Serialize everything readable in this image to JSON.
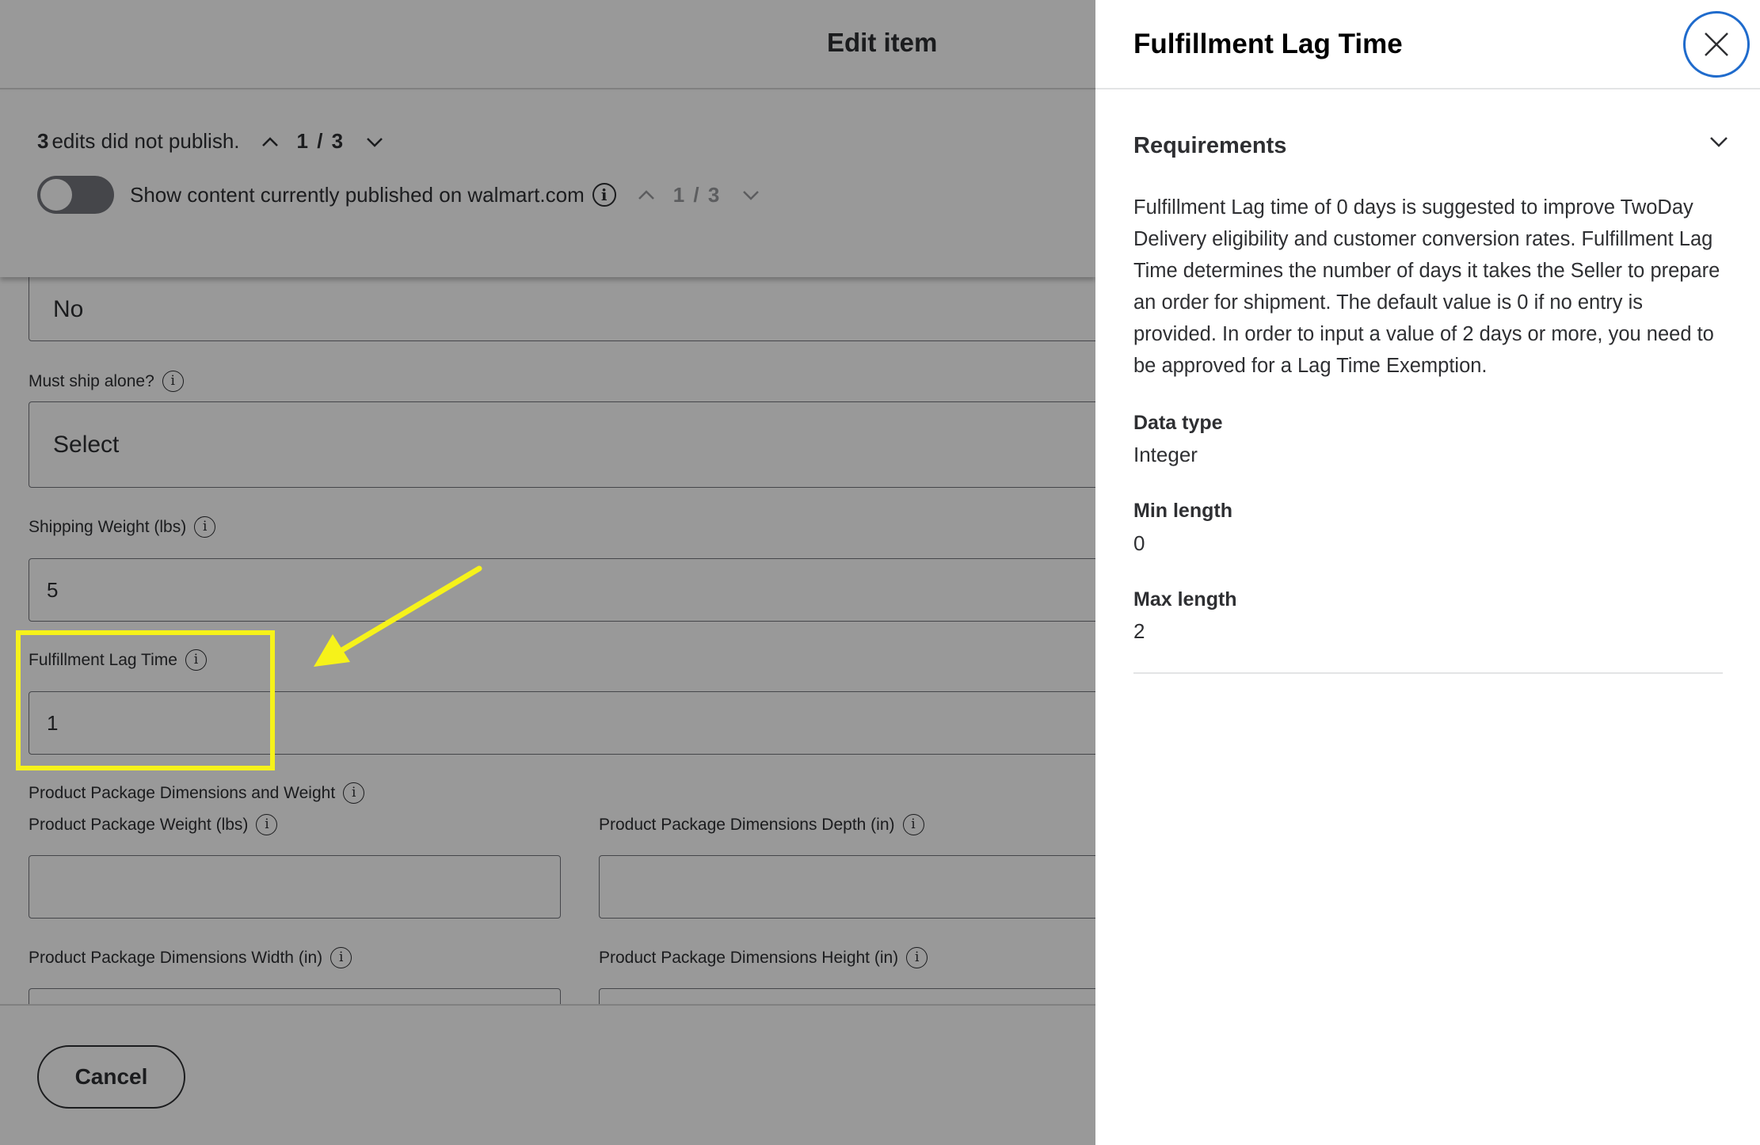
{
  "editor": {
    "title": "Edit item",
    "publish_status": {
      "count": "3",
      "text": "edits did not publish.",
      "pager": "1 / 3",
      "toggle_label": "Show content currently published on walmart.com",
      "toggle_on": false,
      "toggle_pager": "1 / 3"
    },
    "fields": {
      "top_select_value": "No",
      "must_ship_alone": {
        "label": "Must ship alone?",
        "value": "Select"
      },
      "shipping_weight": {
        "label": "Shipping Weight (lbs)",
        "value": "5"
      },
      "fulfillment_lag_time": {
        "label": "Fulfillment Lag Time",
        "value": "1"
      },
      "package_section": {
        "label": "Product Package Dimensions and Weight"
      },
      "package_weight": {
        "label": "Product Package Weight (lbs)",
        "value": ""
      },
      "package_depth": {
        "label": "Product Package Dimensions Depth (in)",
        "value": ""
      },
      "package_width": {
        "label": "Product Package Dimensions Width (in)",
        "value": ""
      },
      "package_height": {
        "label": "Product Package Dimensions Height (in)",
        "value": ""
      }
    },
    "footer": {
      "cancel_label": "Cancel"
    }
  },
  "panel": {
    "title": "Fulfillment Lag Time",
    "requirements_heading": "Requirements",
    "requirements_text": "Fulfillment Lag time of 0 days is suggested to improve TwoDay Delivery eligibility and customer conversion rates. Fulfillment Lag Time determines the number of days it takes the Seller to prepare an order for shipment. The default value is 0 if no entry is provided. In order to input a value of 2 days or more, you need to be approved for a Lag Time Exemption.",
    "specs": [
      {
        "label": "Data type",
        "value": "Integer"
      },
      {
        "label": "Min length",
        "value": "0"
      },
      {
        "label": "Max length",
        "value": "2"
      }
    ]
  },
  "icons": {
    "info": "info-icon",
    "close": "close-icon",
    "chevron_up": "chevron-up-icon",
    "chevron_down": "chevron-down-icon"
  },
  "colors": {
    "highlight": "#f6f21a",
    "close_ring": "#1f6bcc",
    "overlay": "rgba(0,0,0,0.4)",
    "toggle_off": "#74767c"
  }
}
